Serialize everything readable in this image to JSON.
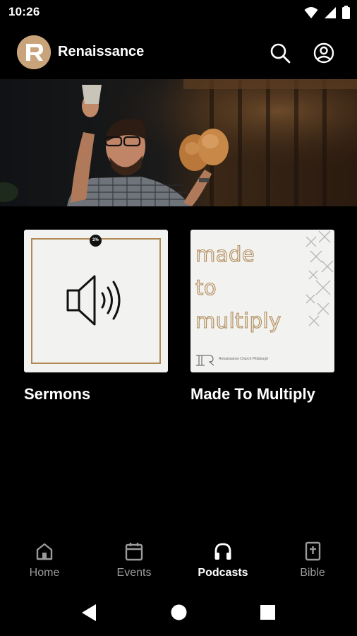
{
  "status_bar": {
    "time": "10:26",
    "icons": [
      "wifi-icon",
      "cellular-icon",
      "battery-icon"
    ]
  },
  "app_bar": {
    "title": "Renaissance",
    "logo_letter": "R",
    "actions": [
      "search-icon",
      "account-icon"
    ]
  },
  "hero": {
    "icon": "hero-photo-preacher"
  },
  "podcasts": [
    {
      "title": "Sermons",
      "artwork_badge": "2%",
      "artwork_icon": "speaker-volume-icon"
    },
    {
      "title": "Made To Multiply",
      "artwork_words": [
        "made",
        "to",
        "multiply"
      ],
      "artwork_footer": "Renaissance Church Pittsburgh"
    }
  ],
  "bottom_nav": {
    "items": [
      {
        "label": "Home",
        "icon": "home-icon",
        "active": false
      },
      {
        "label": "Events",
        "icon": "calendar-icon",
        "active": false
      },
      {
        "label": "Podcasts",
        "icon": "headphones-icon",
        "active": true
      },
      {
        "label": "Bible",
        "icon": "bible-icon",
        "active": false
      }
    ]
  },
  "system_nav": [
    "back-icon",
    "home-circle-icon",
    "recents-icon"
  ],
  "colors": {
    "background": "#000000",
    "brand_gold": "#c9a47a",
    "art_stroke": "#b08a57",
    "nav_inactive": "#9a9a9a",
    "nav_active": "#ffffff"
  }
}
